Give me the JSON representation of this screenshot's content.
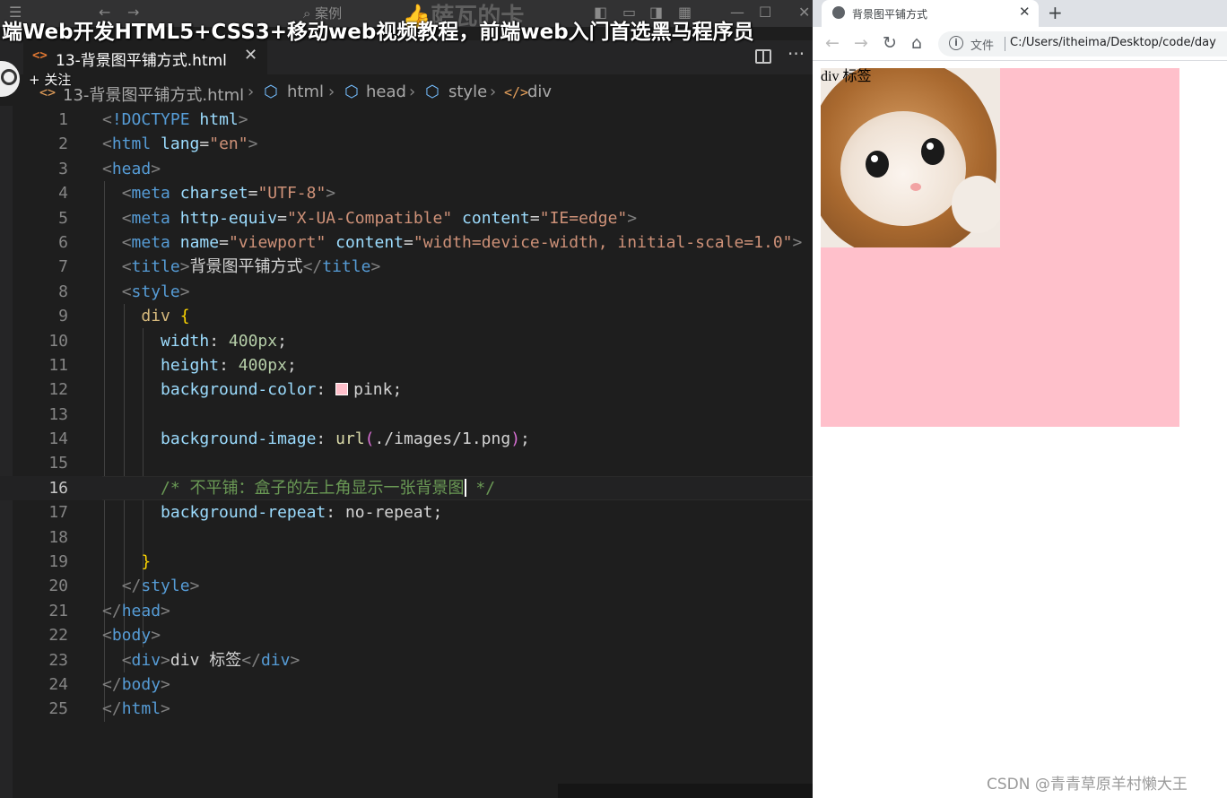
{
  "overlay": {
    "course_title": "端Web开发HTML5+CSS3+移动web视频教程，前端web入门首选黑马程序员",
    "follow_label": "关注",
    "follow_icon": "plus-icon",
    "search_text": "案例",
    "brand_text": "萨瓦的卡",
    "watermark": "CSDN @青青草原羊村懒大王"
  },
  "editor": {
    "tab": {
      "label": "13-背景图平铺方式.html",
      "icon": "html-file-icon"
    },
    "breadcrumb": [
      "13-背景图平铺方式.html",
      "html",
      "head",
      "style",
      "div"
    ],
    "active_line": 16,
    "lines": [
      {
        "n": "1"
      },
      {
        "n": "2"
      },
      {
        "n": "3"
      },
      {
        "n": "4"
      },
      {
        "n": "5"
      },
      {
        "n": "6"
      },
      {
        "n": "7"
      },
      {
        "n": "8"
      },
      {
        "n": "9"
      },
      {
        "n": "10"
      },
      {
        "n": "11"
      },
      {
        "n": "12"
      },
      {
        "n": "13"
      },
      {
        "n": "14"
      },
      {
        "n": "15"
      },
      {
        "n": "16"
      },
      {
        "n": "17"
      },
      {
        "n": "18"
      },
      {
        "n": "19"
      },
      {
        "n": "20"
      },
      {
        "n": "21"
      },
      {
        "n": "22"
      },
      {
        "n": "23"
      },
      {
        "n": "24"
      },
      {
        "n": "25"
      }
    ],
    "code": {
      "doctype": "!DOCTYPE",
      "html": "html",
      "lang": "lang",
      "en": "\"en\"",
      "head": "head",
      "meta": "meta",
      "charset": "charset",
      "utf8": "\"UTF-8\"",
      "http_equiv": "http-equiv",
      "xua": "\"X-UA-Compatible\"",
      "content": "content",
      "ie_edge": "\"IE=edge\"",
      "name": "name",
      "viewport": "\"viewport\"",
      "viewport_content": "\"width=device-width, initial-scale=1.0\"",
      "title": "title",
      "title_text": "背景图平铺方式",
      "style": "style",
      "div": "div",
      "width": "width",
      "height": "height",
      "px400": "400px",
      "bgcolor": "background-color",
      "pink": "pink",
      "bgimage": "background-image",
      "url_fn": "url",
      "url_path": "./images/1.png",
      "comment_open": "/* 不平铺：盒子的左上角显示一张背景图",
      "comment_close": " */",
      "bgrepeat": "background-repeat",
      "norepeat": "no-repeat",
      "body": "body",
      "div_text": "div 标签"
    },
    "colors": {
      "swatch": "#ffc0cb"
    }
  },
  "browser": {
    "tab_title": "背景图平铺方式",
    "new_tab": "+",
    "scheme_label": "文件",
    "url": "C:/Users/itheima/Desktop/code/day",
    "page_text": "div 标签",
    "demo_bg_color": "#ffc0cb",
    "bg_repeat": "no-repeat"
  }
}
